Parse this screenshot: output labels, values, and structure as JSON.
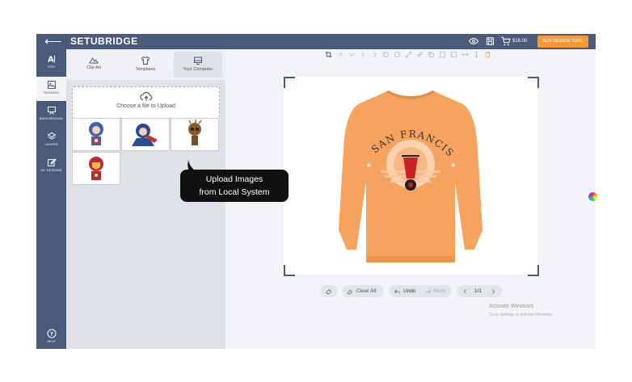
{
  "topbar": {
    "back_icon": "arrow-left-icon",
    "brand": "SETUBRIDGE",
    "price": "$16.00",
    "buy_button": "BUY DESIGN TOOL"
  },
  "sidebar": {
    "items": [
      {
        "label": "TEXT",
        "icon": "text-icon"
      },
      {
        "label": "DESIGNS",
        "icon": "image-icon"
      },
      {
        "label": "BACKGROUND",
        "icon": "easel-icon"
      },
      {
        "label": "LAYERS",
        "icon": "layers-icon"
      },
      {
        "label": "MY DESIGNS",
        "icon": "edit-icon"
      }
    ],
    "help_label": "HELP"
  },
  "panel": {
    "tabs": [
      {
        "label": "Clip Art",
        "icon": "mountain-icon"
      },
      {
        "label": "Templates",
        "icon": "shirt-icon"
      },
      {
        "label": "Your Computer",
        "icon": "monitor-icon"
      }
    ],
    "upload_label": "Choose a file to Upload",
    "thumbnails": [
      "captain-america-chibi",
      "captain-america-flying",
      "groot",
      "iron-man"
    ]
  },
  "tooltip": {
    "line1": "Upload Images",
    "line2": "from Local System"
  },
  "canvas": {
    "shirt_text": "SAN FRANCISCO",
    "shirt_color": "#f5a35f"
  },
  "bottom": {
    "clear_all": "Clear All",
    "undo": "Undo",
    "redo": "Redo",
    "page": "1/1"
  },
  "watermark": {
    "line1": "Activate Windows",
    "line2": "Go to Settings to activate Windows."
  },
  "colors": {
    "primary": "#4a5a7a",
    "accent": "#f39a37"
  }
}
